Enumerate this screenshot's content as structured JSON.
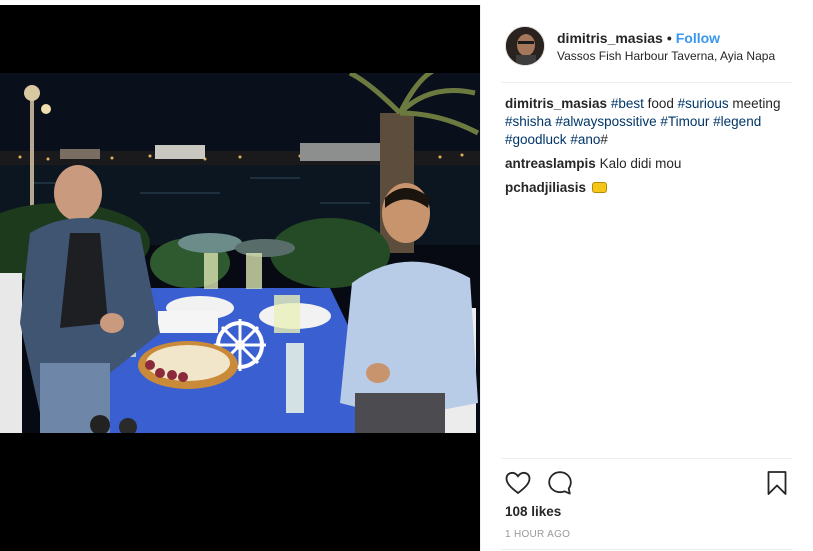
{
  "post": {
    "username": "dimitris_masias",
    "separator": "•",
    "follow_label": "Follow",
    "location": "Vassos Fish Harbour Taverna, Ayia Napa"
  },
  "caption": {
    "username": "dimitris_masias",
    "parts": [
      "#best",
      " food ",
      "#surious",
      " meeting ",
      "#shisha",
      " ",
      "#alwayspossitive",
      " ",
      "#Timour",
      " ",
      "#legend",
      " ",
      "#goodluck",
      " ",
      "#ano",
      "#"
    ]
  },
  "comments": [
    {
      "username": "antreaslampis",
      "text": "Kalo didi mou"
    },
    {
      "username": "pchadjiliasis",
      "text": "",
      "icon": "emoji-icon"
    }
  ],
  "actions": {
    "like_icon": "heart-icon",
    "comment_icon": "comment-icon",
    "save_icon": "bookmark-icon"
  },
  "likes": "108 likes",
  "timestamp": "1 HOUR AGO",
  "colors": {
    "accent": "#3897f0",
    "hashtag": "#003569",
    "text": "#262626",
    "muted": "#999999"
  }
}
